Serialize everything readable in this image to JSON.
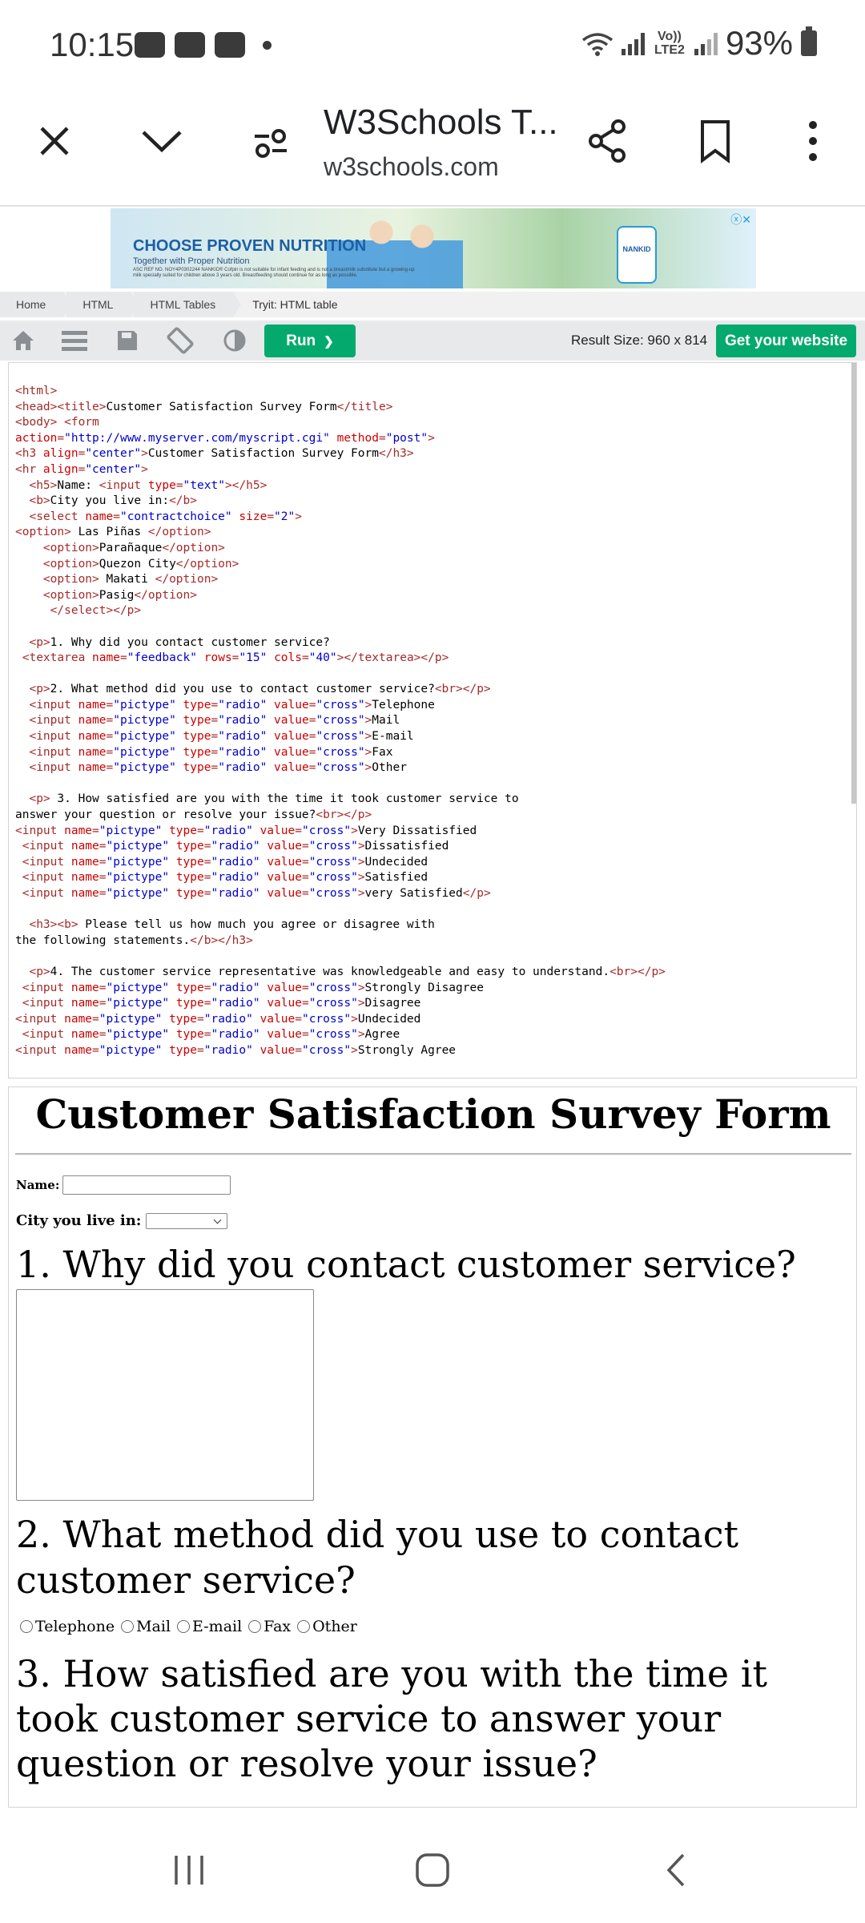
{
  "status_bar": {
    "time": "10:15",
    "network_label": "Vo)) LTE2",
    "battery": "93%"
  },
  "browser": {
    "title": "W3Schools T...",
    "url": "w3schools.com",
    "icons": [
      "close-icon",
      "chevron-down-icon",
      "page-settings-icon",
      "share-icon",
      "bookmark-icon",
      "more-vert-icon"
    ]
  },
  "ad": {
    "headline": "CHOOSE PROVEN NUTRITION",
    "subline": "Together with Proper Nutrition",
    "fine_print": "ASC REF NO. NOY4P0302244 NANKID® Cofpin is not suitable for infant feeding and is not a breastmilk substitute but a growing-up milk specially suited for children above 3 years old. Breastfeeding should continue for as long as possible.",
    "product_label": "NANKID",
    "close_glyph": "ⓧ✕"
  },
  "breadcrumb": [
    "Home",
    "HTML",
    "HTML Tables",
    "Tryit: HTML table"
  ],
  "editor_bar": {
    "run_label": "Run",
    "run_glyph": "❯",
    "result_size": "Result Size: 960 x 814",
    "get_website_label": "Get your website"
  },
  "code_lines": [
    [
      [
        "t",
        "<html>"
      ]
    ],
    [
      [
        "t",
        "<head><title>"
      ],
      [
        "x",
        "Customer Satisfaction Survey Form"
      ],
      [
        "t",
        "</title>"
      ]
    ],
    [
      [
        "t",
        "<body> <form"
      ]
    ],
    [
      [
        "a",
        "action"
      ],
      [
        "t",
        "="
      ],
      [
        "v",
        "\"http://www.myserver.com/myscript.cgi\""
      ],
      [
        "x",
        " "
      ],
      [
        "a",
        "method"
      ],
      [
        "t",
        "="
      ],
      [
        "v",
        "\"post\""
      ],
      [
        "t",
        ">"
      ]
    ],
    [
      [
        "t",
        "<h3 "
      ],
      [
        "a",
        "align"
      ],
      [
        "t",
        "="
      ],
      [
        "v",
        "\"center\""
      ],
      [
        "t",
        ">"
      ],
      [
        "x",
        "Customer Satisfaction Survey Form"
      ],
      [
        "t",
        "</h3>"
      ]
    ],
    [
      [
        "t",
        "<hr "
      ],
      [
        "a",
        "align"
      ],
      [
        "t",
        "="
      ],
      [
        "v",
        "\"center\""
      ],
      [
        "t",
        ">"
      ]
    ],
    [
      [
        "x",
        "  "
      ],
      [
        "t",
        "<h5>"
      ],
      [
        "x",
        "Name: "
      ],
      [
        "t",
        "<input "
      ],
      [
        "a",
        "type"
      ],
      [
        "t",
        "="
      ],
      [
        "v",
        "\"text\""
      ],
      [
        "t",
        "></h5>"
      ]
    ],
    [
      [
        "x",
        "  "
      ],
      [
        "t",
        "<b>"
      ],
      [
        "x",
        "City you live in:"
      ],
      [
        "t",
        "</b>"
      ]
    ],
    [
      [
        "x",
        "  "
      ],
      [
        "t",
        "<select "
      ],
      [
        "a",
        "name"
      ],
      [
        "t",
        "="
      ],
      [
        "v",
        "\"contractchoice\""
      ],
      [
        "x",
        " "
      ],
      [
        "a",
        "size"
      ],
      [
        "t",
        "="
      ],
      [
        "v",
        "\"2\""
      ],
      [
        "t",
        ">"
      ]
    ],
    [
      [
        "t",
        "<option>"
      ],
      [
        "x",
        " Las Piñas "
      ],
      [
        "t",
        "</option>"
      ]
    ],
    [
      [
        "x",
        "    "
      ],
      [
        "t",
        "<option>"
      ],
      [
        "x",
        "Parañaque"
      ],
      [
        "t",
        "</option>"
      ]
    ],
    [
      [
        "x",
        "    "
      ],
      [
        "t",
        "<option>"
      ],
      [
        "x",
        "Quezon City"
      ],
      [
        "t",
        "</option>"
      ]
    ],
    [
      [
        "x",
        "    "
      ],
      [
        "t",
        "<option>"
      ],
      [
        "x",
        " Makati "
      ],
      [
        "t",
        "</option>"
      ]
    ],
    [
      [
        "x",
        "    "
      ],
      [
        "t",
        "<option>"
      ],
      [
        "x",
        "Pasig"
      ],
      [
        "t",
        "</option>"
      ]
    ],
    [
      [
        "x",
        "     "
      ],
      [
        "t",
        "</select></p>"
      ]
    ],
    [],
    [
      [
        "x",
        "  "
      ],
      [
        "t",
        "<p>"
      ],
      [
        "x",
        "1. Why did you contact customer service?"
      ]
    ],
    [
      [
        "x",
        " "
      ],
      [
        "t",
        "<textarea "
      ],
      [
        "a",
        "name"
      ],
      [
        "t",
        "="
      ],
      [
        "v",
        "\"feedback\""
      ],
      [
        "x",
        " "
      ],
      [
        "a",
        "rows"
      ],
      [
        "t",
        "="
      ],
      [
        "v",
        "\"15\""
      ],
      [
        "x",
        " "
      ],
      [
        "a",
        "cols"
      ],
      [
        "t",
        "="
      ],
      [
        "v",
        "\"40\""
      ],
      [
        "t",
        "></textarea></p>"
      ]
    ],
    [],
    [
      [
        "x",
        "  "
      ],
      [
        "t",
        "<p>"
      ],
      [
        "x",
        "2. What method did you use to contact customer service?"
      ],
      [
        "t",
        "<br></p>"
      ]
    ],
    [
      [
        "x",
        "  "
      ],
      [
        "t",
        "<input "
      ],
      [
        "a",
        "name"
      ],
      [
        "t",
        "="
      ],
      [
        "v",
        "\"pictype\""
      ],
      [
        "x",
        " "
      ],
      [
        "a",
        "type"
      ],
      [
        "t",
        "="
      ],
      [
        "v",
        "\"radio\""
      ],
      [
        "x",
        " "
      ],
      [
        "a",
        "value"
      ],
      [
        "t",
        "="
      ],
      [
        "v",
        "\"cross\""
      ],
      [
        "t",
        ">"
      ],
      [
        "x",
        "Telephone"
      ]
    ],
    [
      [
        "x",
        "  "
      ],
      [
        "t",
        "<input "
      ],
      [
        "a",
        "name"
      ],
      [
        "t",
        "="
      ],
      [
        "v",
        "\"pictype\""
      ],
      [
        "x",
        " "
      ],
      [
        "a",
        "type"
      ],
      [
        "t",
        "="
      ],
      [
        "v",
        "\"radio\""
      ],
      [
        "x",
        " "
      ],
      [
        "a",
        "value"
      ],
      [
        "t",
        "="
      ],
      [
        "v",
        "\"cross\""
      ],
      [
        "t",
        ">"
      ],
      [
        "x",
        "Mail"
      ]
    ],
    [
      [
        "x",
        "  "
      ],
      [
        "t",
        "<input "
      ],
      [
        "a",
        "name"
      ],
      [
        "t",
        "="
      ],
      [
        "v",
        "\"pictype\""
      ],
      [
        "x",
        " "
      ],
      [
        "a",
        "type"
      ],
      [
        "t",
        "="
      ],
      [
        "v",
        "\"radio\""
      ],
      [
        "x",
        " "
      ],
      [
        "a",
        "value"
      ],
      [
        "t",
        "="
      ],
      [
        "v",
        "\"cross\""
      ],
      [
        "t",
        ">"
      ],
      [
        "x",
        "E-mail"
      ]
    ],
    [
      [
        "x",
        "  "
      ],
      [
        "t",
        "<input "
      ],
      [
        "a",
        "name"
      ],
      [
        "t",
        "="
      ],
      [
        "v",
        "\"pictype\""
      ],
      [
        "x",
        " "
      ],
      [
        "a",
        "type"
      ],
      [
        "t",
        "="
      ],
      [
        "v",
        "\"radio\""
      ],
      [
        "x",
        " "
      ],
      [
        "a",
        "value"
      ],
      [
        "t",
        "="
      ],
      [
        "v",
        "\"cross\""
      ],
      [
        "t",
        ">"
      ],
      [
        "x",
        "Fax"
      ]
    ],
    [
      [
        "x",
        "  "
      ],
      [
        "t",
        "<input "
      ],
      [
        "a",
        "name"
      ],
      [
        "t",
        "="
      ],
      [
        "v",
        "\"pictype\""
      ],
      [
        "x",
        " "
      ],
      [
        "a",
        "type"
      ],
      [
        "t",
        "="
      ],
      [
        "v",
        "\"radio\""
      ],
      [
        "x",
        " "
      ],
      [
        "a",
        "value"
      ],
      [
        "t",
        "="
      ],
      [
        "v",
        "\"cross\""
      ],
      [
        "t",
        ">"
      ],
      [
        "x",
        "Other"
      ]
    ],
    [],
    [
      [
        "x",
        "  "
      ],
      [
        "t",
        "<p>"
      ],
      [
        "x",
        " 3. How satisfied are you with the time it took customer service to"
      ]
    ],
    [
      [
        "x",
        "answer your question or resolve your issue?"
      ],
      [
        "t",
        "<br></p>"
      ]
    ],
    [
      [
        "t",
        "<input "
      ],
      [
        "a",
        "name"
      ],
      [
        "t",
        "="
      ],
      [
        "v",
        "\"pictype\""
      ],
      [
        "x",
        " "
      ],
      [
        "a",
        "type"
      ],
      [
        "t",
        "="
      ],
      [
        "v",
        "\"radio\""
      ],
      [
        "x",
        " "
      ],
      [
        "a",
        "value"
      ],
      [
        "t",
        "="
      ],
      [
        "v",
        "\"cross\""
      ],
      [
        "t",
        ">"
      ],
      [
        "x",
        "Very Dissatisfied"
      ]
    ],
    [
      [
        "x",
        " "
      ],
      [
        "t",
        "<input "
      ],
      [
        "a",
        "name"
      ],
      [
        "t",
        "="
      ],
      [
        "v",
        "\"pictype\""
      ],
      [
        "x",
        " "
      ],
      [
        "a",
        "type"
      ],
      [
        "t",
        "="
      ],
      [
        "v",
        "\"radio\""
      ],
      [
        "x",
        " "
      ],
      [
        "a",
        "value"
      ],
      [
        "t",
        "="
      ],
      [
        "v",
        "\"cross\""
      ],
      [
        "t",
        ">"
      ],
      [
        "x",
        "Dissatisfied"
      ]
    ],
    [
      [
        "x",
        " "
      ],
      [
        "t",
        "<input "
      ],
      [
        "a",
        "name"
      ],
      [
        "t",
        "="
      ],
      [
        "v",
        "\"pictype\""
      ],
      [
        "x",
        " "
      ],
      [
        "a",
        "type"
      ],
      [
        "t",
        "="
      ],
      [
        "v",
        "\"radio\""
      ],
      [
        "x",
        " "
      ],
      [
        "a",
        "value"
      ],
      [
        "t",
        "="
      ],
      [
        "v",
        "\"cross\""
      ],
      [
        "t",
        ">"
      ],
      [
        "x",
        "Undecided"
      ]
    ],
    [
      [
        "x",
        " "
      ],
      [
        "t",
        "<input "
      ],
      [
        "a",
        "name"
      ],
      [
        "t",
        "="
      ],
      [
        "v",
        "\"pictype\""
      ],
      [
        "x",
        " "
      ],
      [
        "a",
        "type"
      ],
      [
        "t",
        "="
      ],
      [
        "v",
        "\"radio\""
      ],
      [
        "x",
        " "
      ],
      [
        "a",
        "value"
      ],
      [
        "t",
        "="
      ],
      [
        "v",
        "\"cross\""
      ],
      [
        "t",
        ">"
      ],
      [
        "x",
        "Satisfied"
      ]
    ],
    [
      [
        "x",
        " "
      ],
      [
        "t",
        "<input "
      ],
      [
        "a",
        "name"
      ],
      [
        "t",
        "="
      ],
      [
        "v",
        "\"pictype\""
      ],
      [
        "x",
        " "
      ],
      [
        "a",
        "type"
      ],
      [
        "t",
        "="
      ],
      [
        "v",
        "\"radio\""
      ],
      [
        "x",
        " "
      ],
      [
        "a",
        "value"
      ],
      [
        "t",
        "="
      ],
      [
        "v",
        "\"cross\""
      ],
      [
        "t",
        ">"
      ],
      [
        "x",
        "very Satisfied"
      ],
      [
        "t",
        "</p>"
      ]
    ],
    [],
    [
      [
        "x",
        "  "
      ],
      [
        "t",
        "<h3><b>"
      ],
      [
        "x",
        " Please tell us how much you agree or disagree with"
      ]
    ],
    [
      [
        "x",
        "the following statements."
      ],
      [
        "t",
        "</b></h3>"
      ]
    ],
    [],
    [
      [
        "x",
        "  "
      ],
      [
        "t",
        "<p>"
      ],
      [
        "x",
        "4. The customer service representative was knowledgeable and easy to understand."
      ],
      [
        "t",
        "<br></p>"
      ]
    ],
    [
      [
        "x",
        " "
      ],
      [
        "t",
        "<input "
      ],
      [
        "a",
        "name"
      ],
      [
        "t",
        "="
      ],
      [
        "v",
        "\"pictype\""
      ],
      [
        "x",
        " "
      ],
      [
        "a",
        "type"
      ],
      [
        "t",
        "="
      ],
      [
        "v",
        "\"radio\""
      ],
      [
        "x",
        " "
      ],
      [
        "a",
        "value"
      ],
      [
        "t",
        "="
      ],
      [
        "v",
        "\"cross\""
      ],
      [
        "t",
        ">"
      ],
      [
        "x",
        "Strongly Disagree"
      ]
    ],
    [
      [
        "x",
        " "
      ],
      [
        "t",
        "<input "
      ],
      [
        "a",
        "name"
      ],
      [
        "t",
        "="
      ],
      [
        "v",
        "\"pictype\""
      ],
      [
        "x",
        " "
      ],
      [
        "a",
        "type"
      ],
      [
        "t",
        "="
      ],
      [
        "v",
        "\"radio\""
      ],
      [
        "x",
        " "
      ],
      [
        "a",
        "value"
      ],
      [
        "t",
        "="
      ],
      [
        "v",
        "\"cross\""
      ],
      [
        "t",
        ">"
      ],
      [
        "x",
        "Disagree"
      ]
    ],
    [
      [
        "t",
        "<input "
      ],
      [
        "a",
        "name"
      ],
      [
        "t",
        "="
      ],
      [
        "v",
        "\"pictype\""
      ],
      [
        "x",
        " "
      ],
      [
        "a",
        "type"
      ],
      [
        "t",
        "="
      ],
      [
        "v",
        "\"radio\""
      ],
      [
        "x",
        " "
      ],
      [
        "a",
        "value"
      ],
      [
        "t",
        "="
      ],
      [
        "v",
        "\"cross\""
      ],
      [
        "t",
        ">"
      ],
      [
        "x",
        "Undecided"
      ]
    ],
    [
      [
        "x",
        " "
      ],
      [
        "t",
        "<input "
      ],
      [
        "a",
        "name"
      ],
      [
        "t",
        "="
      ],
      [
        "v",
        "\"pictype\""
      ],
      [
        "x",
        " "
      ],
      [
        "a",
        "type"
      ],
      [
        "t",
        "="
      ],
      [
        "v",
        "\"radio\""
      ],
      [
        "x",
        " "
      ],
      [
        "a",
        "value"
      ],
      [
        "t",
        "="
      ],
      [
        "v",
        "\"cross\""
      ],
      [
        "t",
        ">"
      ],
      [
        "x",
        "Agree"
      ]
    ],
    [
      [
        "t",
        "<input "
      ],
      [
        "a",
        "name"
      ],
      [
        "t",
        "="
      ],
      [
        "v",
        "\"pictype\""
      ],
      [
        "x",
        " "
      ],
      [
        "a",
        "type"
      ],
      [
        "t",
        "="
      ],
      [
        "v",
        "\"radio\""
      ],
      [
        "x",
        " "
      ],
      [
        "a",
        "value"
      ],
      [
        "t",
        "="
      ],
      [
        "v",
        "\"cross\""
      ],
      [
        "t",
        ">"
      ],
      [
        "x",
        "Strongly Agree"
      ]
    ]
  ],
  "code_colors": {
    "t": "#a52a2a",
    "a": "#cc0000",
    "v": "#0000cd",
    "x": "#000000"
  },
  "result": {
    "heading": "Customer Satisfaction Survey Form",
    "name_label": "Name:",
    "name_value": "",
    "city_label": "City you live in:",
    "q1": "1. Why did you contact customer service?",
    "q2": "2. What method did you use to contact customer service?",
    "q2_options": [
      "Telephone",
      "Mail",
      "E-mail",
      "Fax",
      "Other"
    ],
    "q3": "3. How satisfied are you with the time it took customer service to answer your question or resolve your issue?"
  },
  "colors": {
    "accent_green": "#04aa6d",
    "toolbar_gray": "#e7e9eb"
  }
}
